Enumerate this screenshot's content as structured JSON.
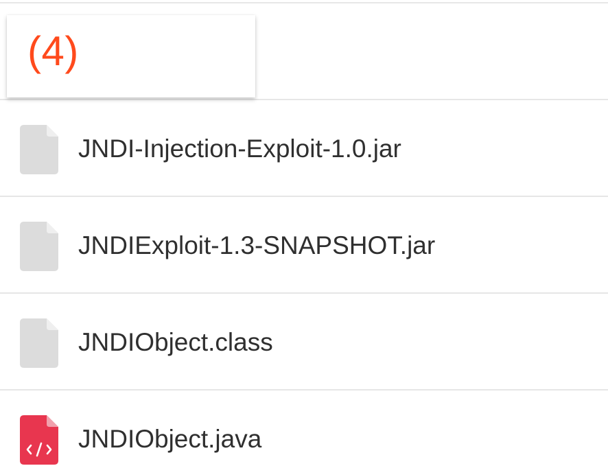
{
  "header": {
    "count_label": "(4)"
  },
  "files": [
    {
      "name": "JNDI-Injection-Exploit-1.0.jar",
      "icon": "generic-file-icon"
    },
    {
      "name": "JNDIExploit-1.3-SNAPSHOT.jar",
      "icon": "generic-file-icon"
    },
    {
      "name": "JNDIObject.class",
      "icon": "generic-file-icon"
    },
    {
      "name": "JNDIObject.java",
      "icon": "code-file-icon"
    }
  ],
  "colors": {
    "count_accent": "#ff4a1c",
    "generic_file_icon": "#dcdcdc",
    "code_file_icon": "#e8364f",
    "text": "#2f2f2f",
    "divider": "#e6e6e6"
  }
}
